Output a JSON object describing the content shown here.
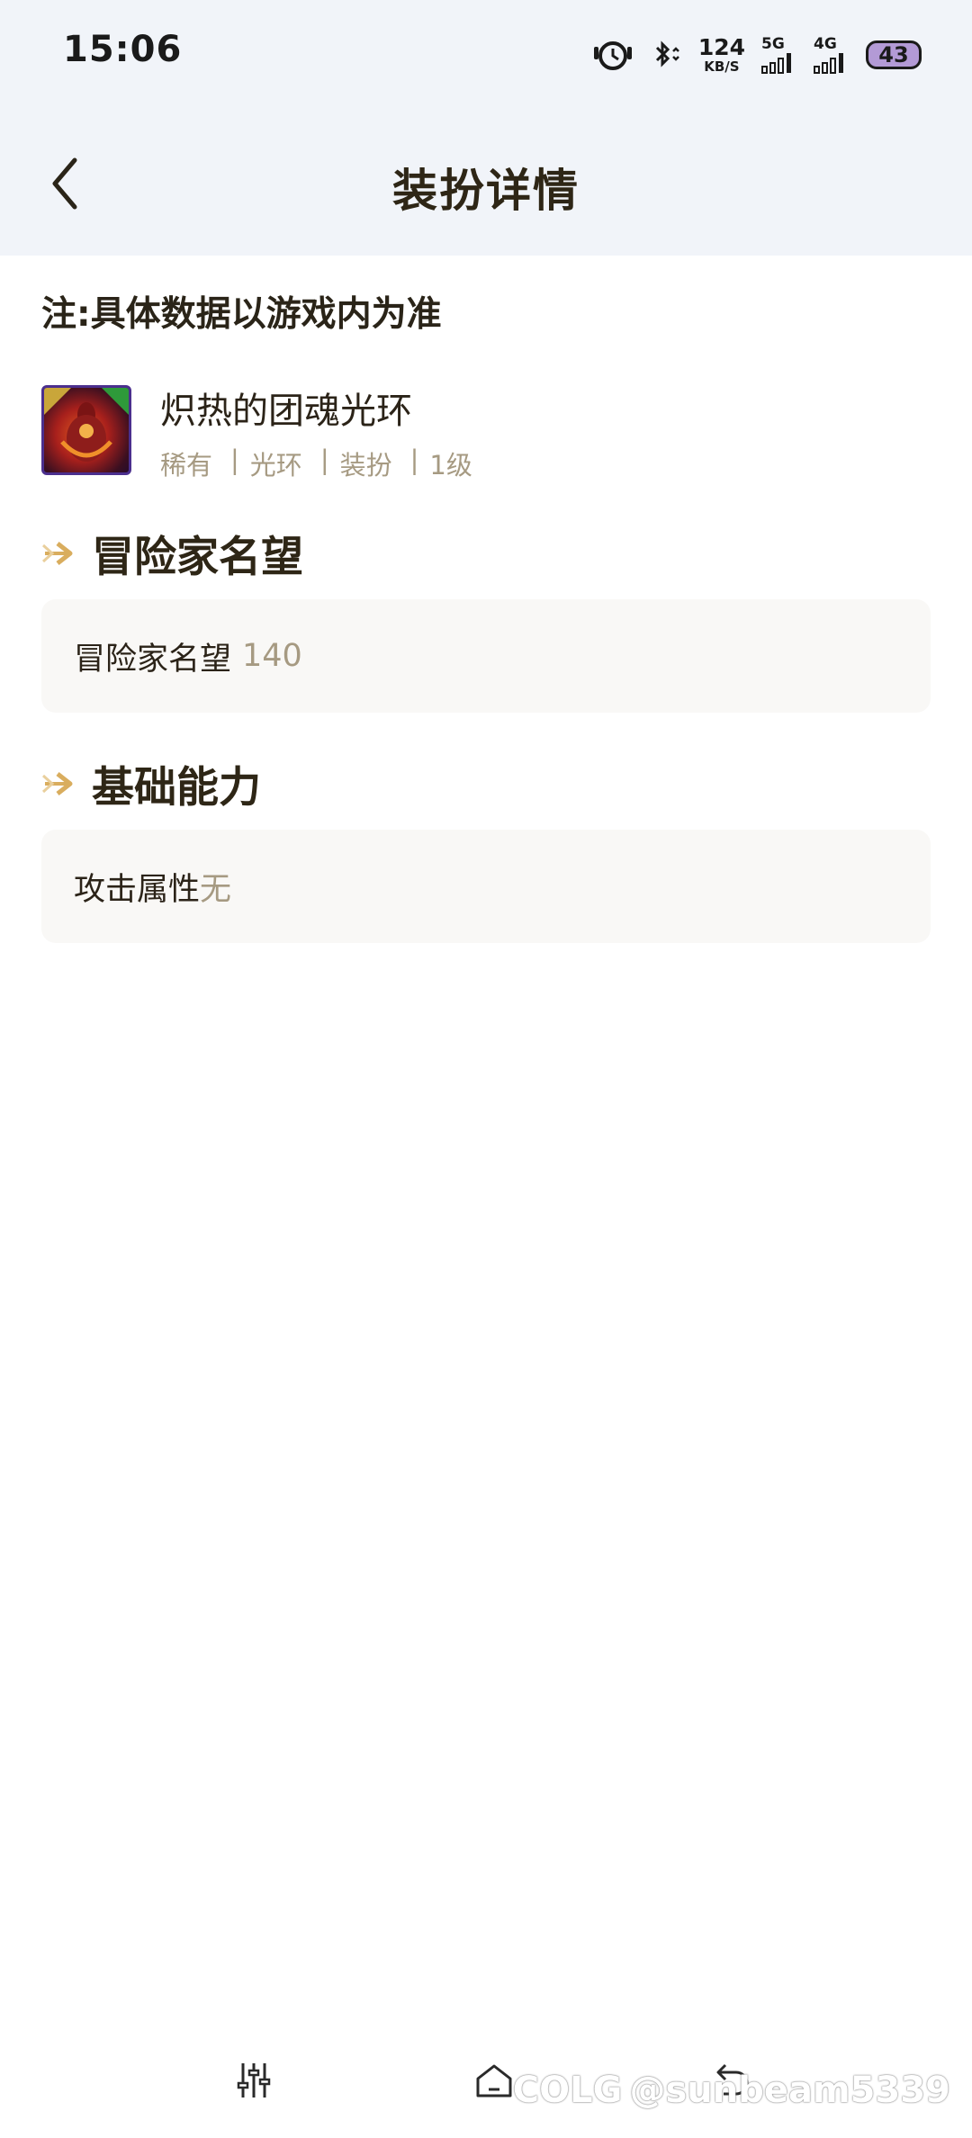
{
  "status_bar": {
    "time": "15:06",
    "net_speed": "124",
    "net_unit": "KB/S",
    "signal1": "5G",
    "signal2": "4G",
    "battery": "43"
  },
  "header": {
    "title": "装扮详情"
  },
  "note": "注:具体数据以游戏内为准",
  "item": {
    "name": "炽热的团魂光环",
    "tags": [
      "稀有",
      "光环",
      "装扮",
      "1级"
    ]
  },
  "sections": [
    {
      "title": "冒险家名望",
      "label": "冒险家名望",
      "value": "140"
    },
    {
      "title": "基础能力",
      "label": "攻击属性",
      "value": "无"
    }
  ],
  "watermark": {
    "logo": "COLG",
    "user": "@sunbeam5339"
  },
  "colors": {
    "header_bg": "#f1f4f9",
    "accent_arrow": "#d9ad5e",
    "muted_text": "#a69a82",
    "card_bg": "#f9f8f6"
  }
}
